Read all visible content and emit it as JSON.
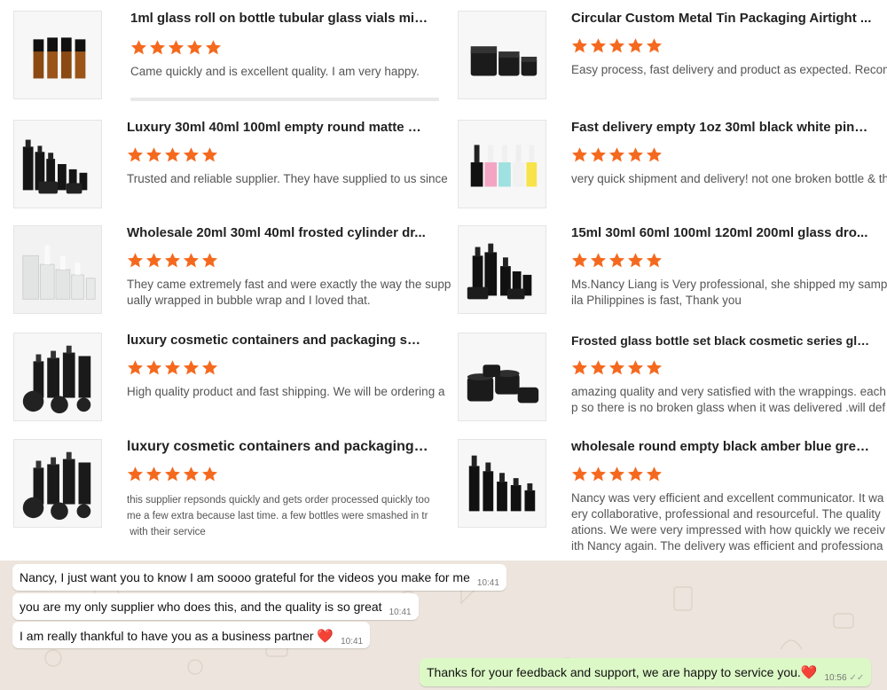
{
  "colors": {
    "star": "#f5691e",
    "chat_bg": "#ede5dd",
    "outgoing_bubble": "#dcf8c6",
    "heart": "#e0102a"
  },
  "reviews": [
    {
      "title": "1ml glass roll on bottle tubular glass vials mini roller ...",
      "stars": 5,
      "comment": "Came quickly and is excellent quality. I am very happy.",
      "icon": "amber-roller-vials"
    },
    {
      "title": "Circular Custom Metal Tin Packaging Airtight ...",
      "stars": 5,
      "comment": "Easy process, fast delivery and product as expected. Recom",
      "icon": "black-jars"
    },
    {
      "title": "Luxury 30ml 40ml 100ml empty round matte bl...",
      "stars": 5,
      "comment": "Trusted and reliable supplier. They have supplied to us since",
      "icon": "black-bottle-set"
    },
    {
      "title": "Fast delivery empty 1oz 30ml black white pink ...",
      "stars": 5,
      "comment": "very quick shipment and delivery! not one broken bottle & th",
      "icon": "colored-dropper-bottles"
    },
    {
      "title": "Wholesale 20ml 30ml 40ml frosted cylinder dr...",
      "stars": 5,
      "comment": "They came extremely fast and were exactly the way the supp\nually wrapped in bubble wrap and I loved that.",
      "icon": "frosted-dropper-bottles"
    },
    {
      "title": "15ml 30ml 60ml 100ml 120ml 200ml glass dro...",
      "stars": 5,
      "comment": "Ms.Nancy Liang is Very professional, she shipped my samp\nila Philippines is fast, Thank you",
      "icon": "black-dropper-set"
    },
    {
      "title": "luxury cosmetic containers and packaging spra...",
      "stars": 5,
      "comment": "High quality product and fast shipping. We will be ordering a",
      "icon": "black-cosmetic-set"
    },
    {
      "title": "Frosted glass bottle set black cosmetic series glass c...",
      "stars": 5,
      "comment": "amazing quality and very satisfied with the wrappings. each\np so there is no broken glass when it was delivered .will def",
      "icon": "black-cream-jars"
    },
    {
      "title": "luxury cosmetic containers and packaging s...",
      "stars": 5,
      "comment": "this supplier repsonds quickly and gets order processed quickly too\nme a few extra because last time. a few bottles were smashed in tr\n with their service",
      "icon": "black-cosmetic-set-2"
    },
    {
      "title": "wholesale round empty black amber blue gree...",
      "stars": 5,
      "comment": "Nancy was very efficient and excellent communicator. It wa\nery collaborative, professional and resourceful. The quality\nations. We were very impressed with how quickly we receiv\nith Nancy again. The delivery was efficient and professiona",
      "icon": "black-pump-bottles"
    }
  ],
  "chat": {
    "messages": [
      {
        "text": "Nancy, I just want you to know I am soooo grateful for the videos you make for me",
        "time": "10:41",
        "heart": ""
      },
      {
        "text": "you are my only supplier who does this, and the quality is so great",
        "time": "10:41",
        "heart": ""
      },
      {
        "text": "I am really thankful to have you as a business partner",
        "time": "10:41",
        "heart": "❤️"
      },
      {
        "text": "Thanks for your feedback and support, we are happy to service you.",
        "time": "10:56",
        "heart": "❤️",
        "ticks": "✓✓"
      }
    ]
  }
}
